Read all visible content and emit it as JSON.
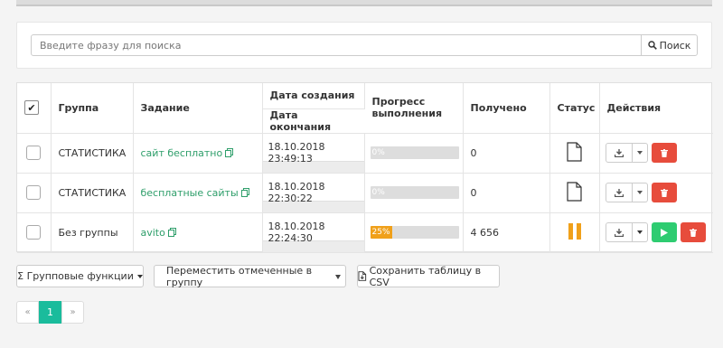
{
  "search": {
    "placeholder": "Введите фразу для поиска",
    "button_label": "Поиск"
  },
  "table": {
    "headers": {
      "group": "Группа",
      "task": "Задание",
      "created": "Дата создания",
      "finished": "Дата окончания",
      "progress": "Прогресс выполнения",
      "received": "Получено",
      "status": "Статус",
      "actions": "Действия"
    },
    "rows": [
      {
        "group": "СТАТИСТИКА",
        "task": "сайт бесплатно",
        "created": "18.10.2018 23:49:13",
        "finished": "",
        "progress_label": "0%",
        "progress": 0,
        "received": "0",
        "status": "file-icon"
      },
      {
        "group": "СТАТИСТИКА",
        "task": "бесплатные сайты",
        "created": "18.10.2018 22:30:22",
        "finished": "",
        "progress_label": "0%",
        "progress": 0,
        "received": "0",
        "status": "file-icon"
      },
      {
        "group": "Без группы",
        "task": "avito",
        "created": "18.10.2018 22:24:30",
        "finished": "",
        "progress_label": "25%",
        "progress": 25,
        "received": "4 656",
        "status": "pause-icon"
      }
    ]
  },
  "bottom": {
    "group_functions_label": "Σ Групповые функции",
    "move_select_value": "Переместить отмеченные в группу",
    "csv_label": "Сохранить таблицу в CSV"
  },
  "pager": {
    "prev": "«",
    "current": "1",
    "next": "»"
  },
  "colors": {
    "accent": "#1abc9c",
    "link": "#2e9e6a",
    "progress": "#f0a01a",
    "delete": "#e74c3c",
    "play": "#2ecc71"
  }
}
